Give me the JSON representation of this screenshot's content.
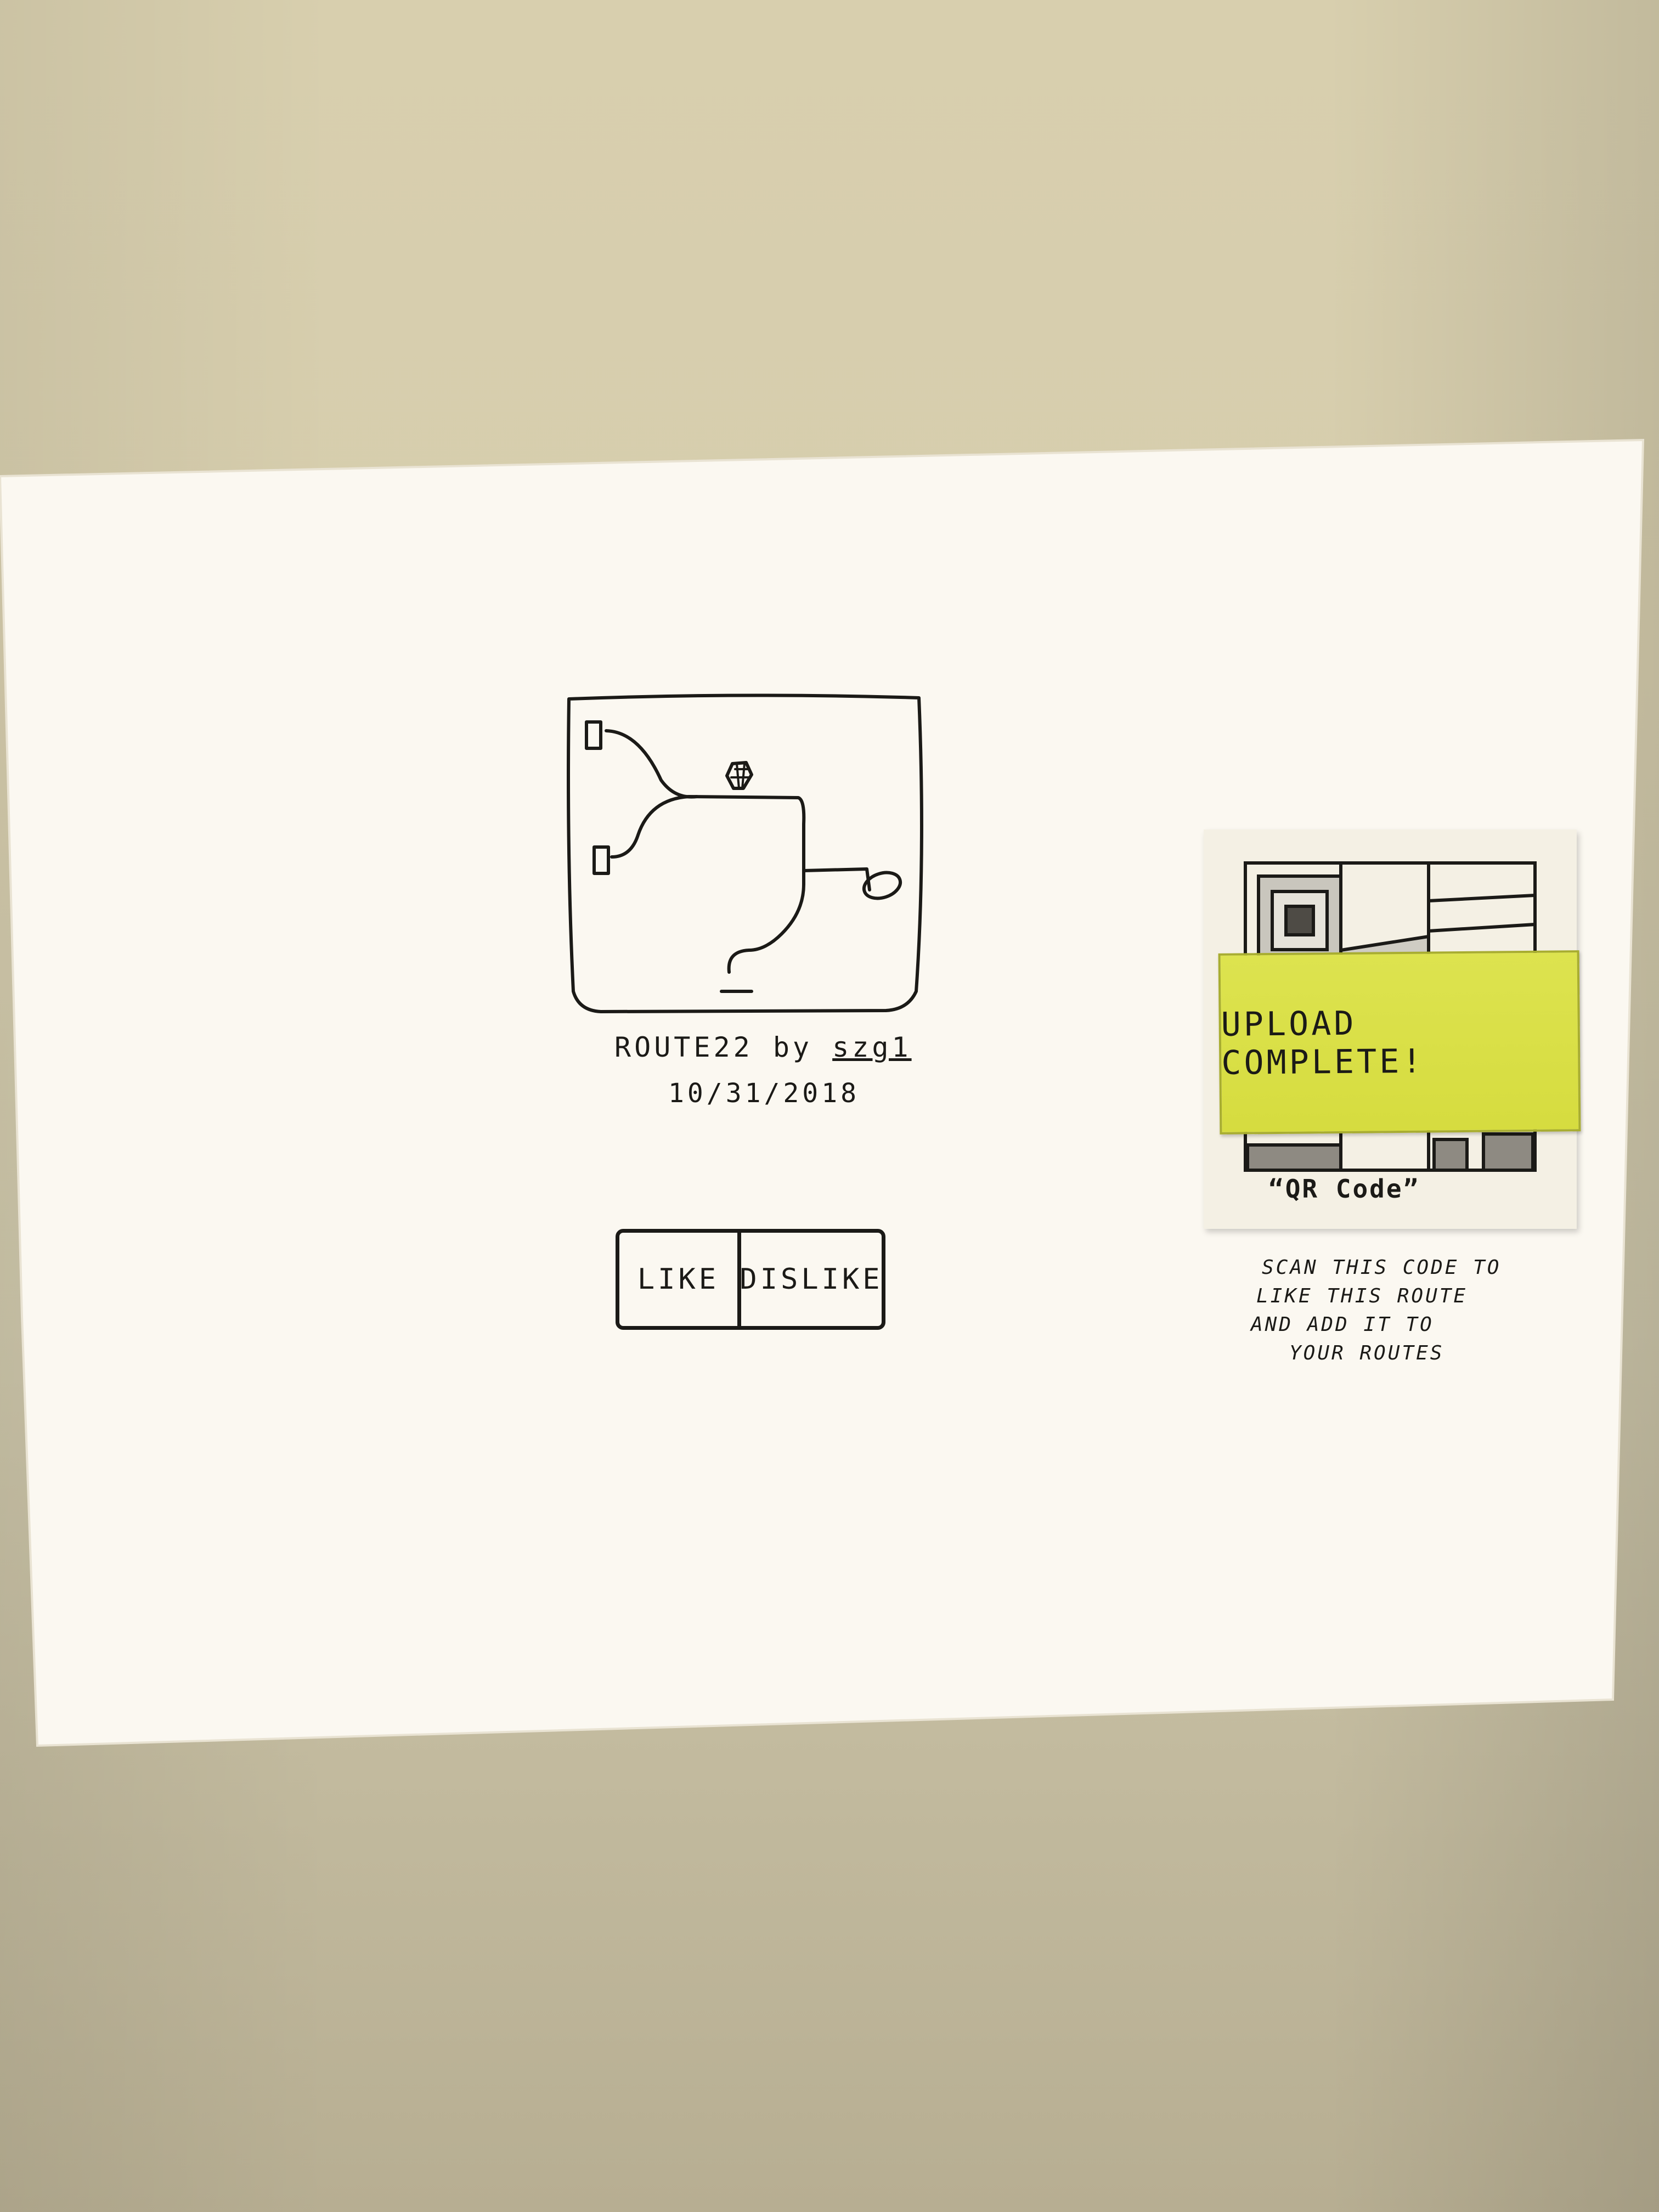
{
  "route": {
    "name": "ROUTE22",
    "by": "by",
    "author": "szg1",
    "date": "10/31/2018"
  },
  "vote": {
    "like_label": "LIKE",
    "dislike_label": "DISLIKE"
  },
  "qr": {
    "caption": "“QR Code”"
  },
  "upload_toast": {
    "message": "UPLOAD COMPLETE!",
    "color": "#dde34f"
  },
  "instructions": {
    "line1": "SCAN THIS CODE TO",
    "line2": "LIKE THIS ROUTE",
    "line3": "AND ADD IT TO",
    "line4": "YOUR ROUTES"
  },
  "icons": {
    "route_map": "hand-drawn-route-map-icon",
    "hold": "climbing-hold-icon",
    "qr": "qr-code-icon"
  }
}
